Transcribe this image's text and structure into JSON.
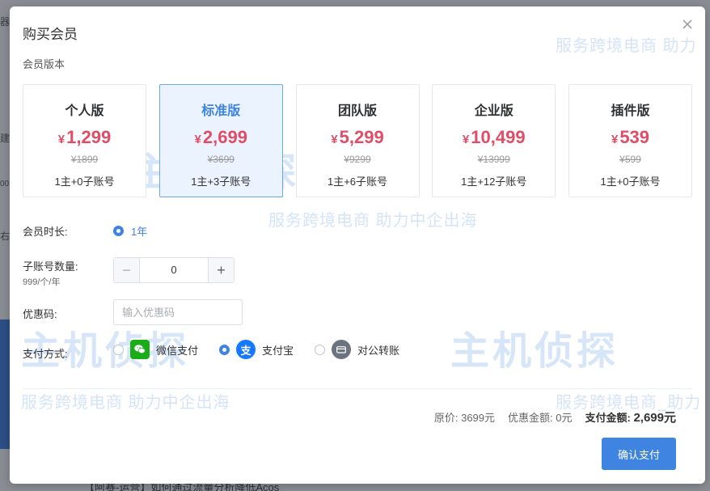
{
  "background": {
    "edge_texts": [
      "器",
      "建",
      "00",
      "右"
    ],
    "bottom_text": "【阿赛-运营】如何通过流量分析降低Acos"
  },
  "modal": {
    "title": "购买会员",
    "section_label": "会员版本"
  },
  "plans": [
    {
      "name": "个人版",
      "currency": "¥",
      "price": "1,299",
      "original": "¥1899",
      "accounts": "1主+0子账号",
      "selected": false
    },
    {
      "name": "标准版",
      "currency": "¥",
      "price": "2,699",
      "original": "¥3699",
      "accounts": "1主+3子账号",
      "selected": true
    },
    {
      "name": "团队版",
      "currency": "¥",
      "price": "5,299",
      "original": "¥9299",
      "accounts": "1主+6子账号",
      "selected": false
    },
    {
      "name": "企业版",
      "currency": "¥",
      "price": "10,499",
      "original": "¥13999",
      "accounts": "1主+12子账号",
      "selected": false
    },
    {
      "name": "插件版",
      "currency": "¥",
      "price": "539",
      "original": "¥599",
      "accounts": "1主+0子账号",
      "selected": false
    }
  ],
  "form": {
    "duration_label": "会员时长:",
    "duration_option": "1年",
    "subaccount_label": "子账号数量:",
    "subaccount_unit": "999/个/年",
    "subaccount_value": "0",
    "minus": "−",
    "plus": "+",
    "coupon_label": "优惠码:",
    "coupon_placeholder": "输入优惠码",
    "payment_label": "支付方式:",
    "payment_options": [
      {
        "label": "微信支付",
        "icon": "wechat-icon",
        "checked": false
      },
      {
        "label": "支付宝",
        "icon": "alipay-icon",
        "checked": true
      },
      {
        "label": "对公转账",
        "icon": "bank-transfer-icon",
        "checked": false
      }
    ]
  },
  "summary": {
    "original": "原价:  3699元",
    "discount": "优惠金额:  0元",
    "total_label": "支付金额:",
    "total_value": "2,699元"
  },
  "confirm_label": "确认支付",
  "watermark": {
    "tagline": "服务跨境电商  助力中企出海",
    "tagline_cut": "服务跨境电商_助力",
    "tagline_right": "服务跨境电商  助力",
    "logo": "主机侦探"
  },
  "colors": {
    "accent": "#3f84e0",
    "price": "#e14d66",
    "selected_bg": "#eaf3fe"
  }
}
